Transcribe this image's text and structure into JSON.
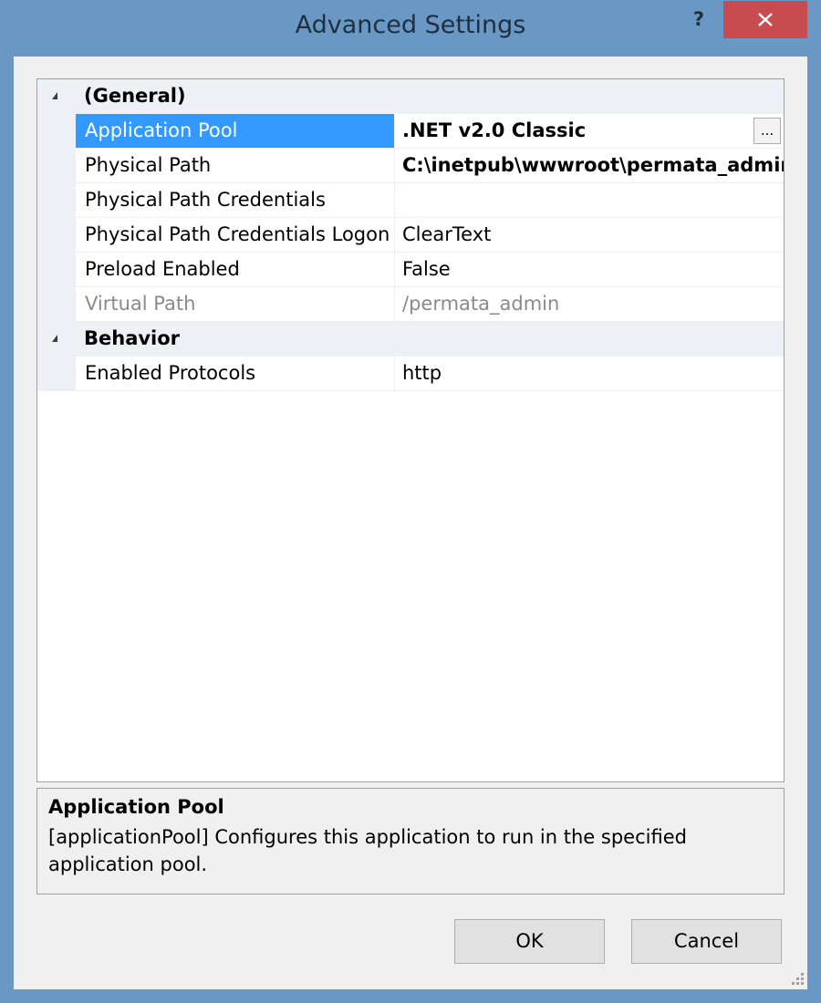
{
  "window": {
    "title": "Advanced Settings",
    "help_label": "?"
  },
  "property_grid": {
    "categories": [
      {
        "label": "(General)",
        "properties": [
          {
            "name": "Application Pool",
            "value": ".NET v2.0 Classic",
            "selected": true,
            "bold_value": true,
            "has_ellipsis": true
          },
          {
            "name": "Physical Path",
            "value": "C:\\inetpub\\wwwroot\\permata_admin",
            "bold_value": true
          },
          {
            "name": "Physical Path Credentials",
            "value": ""
          },
          {
            "name": "Physical Path Credentials Logon",
            "value": "ClearText"
          },
          {
            "name": "Preload Enabled",
            "value": "False"
          },
          {
            "name": "Virtual Path",
            "value": "/permata_admin",
            "disabled": true
          }
        ]
      },
      {
        "label": "Behavior",
        "properties": [
          {
            "name": "Enabled Protocols",
            "value": "http"
          }
        ]
      }
    ],
    "ellipsis_label": "..."
  },
  "description": {
    "title": "Application Pool",
    "text": "[applicationPool] Configures this application to run in the specified application pool."
  },
  "buttons": {
    "ok": "OK",
    "cancel": "Cancel"
  }
}
